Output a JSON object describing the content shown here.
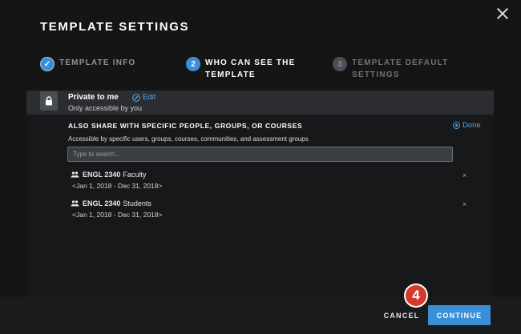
{
  "modal": {
    "title": "TEMPLATE SETTINGS",
    "steps": [
      {
        "number": "✓",
        "label": "TEMPLATE INFO",
        "state": "completed"
      },
      {
        "number": "2",
        "label": "WHO CAN SEE THE TEMPLATE",
        "state": "active"
      },
      {
        "number": "3",
        "label": "TEMPLATE DEFAULT SETTINGS",
        "state": "upcoming"
      }
    ]
  },
  "privacy": {
    "title": "Private to me",
    "subtitle": "Only accessible by you",
    "edit_label": "Edit"
  },
  "share": {
    "heading": "ALSO SHARE WITH SPECIFIC PEOPLE, GROUPS, OR COURSES",
    "done_label": "Done",
    "description": "Accessible by specific users, groups, courses, communities, and assessment groups",
    "search_placeholder": "Type to search...",
    "groups": [
      {
        "code": "ENGL 2340",
        "role": "Faculty",
        "dates": "<Jan 1, 2018 - Dec 31, 2018>",
        "remove": "×"
      },
      {
        "code": "ENGL 2340",
        "role": "Students",
        "dates": "<Jan 1, 2018 - Dec 31, 2018>",
        "remove": "×"
      }
    ]
  },
  "footer": {
    "cancel_label": "CANCEL",
    "continue_label": "CONTINUE",
    "callout_number": "4"
  },
  "colors": {
    "accent": "#3a8fd6",
    "link": "#5aa9ec",
    "callout": "#d23b2b"
  }
}
